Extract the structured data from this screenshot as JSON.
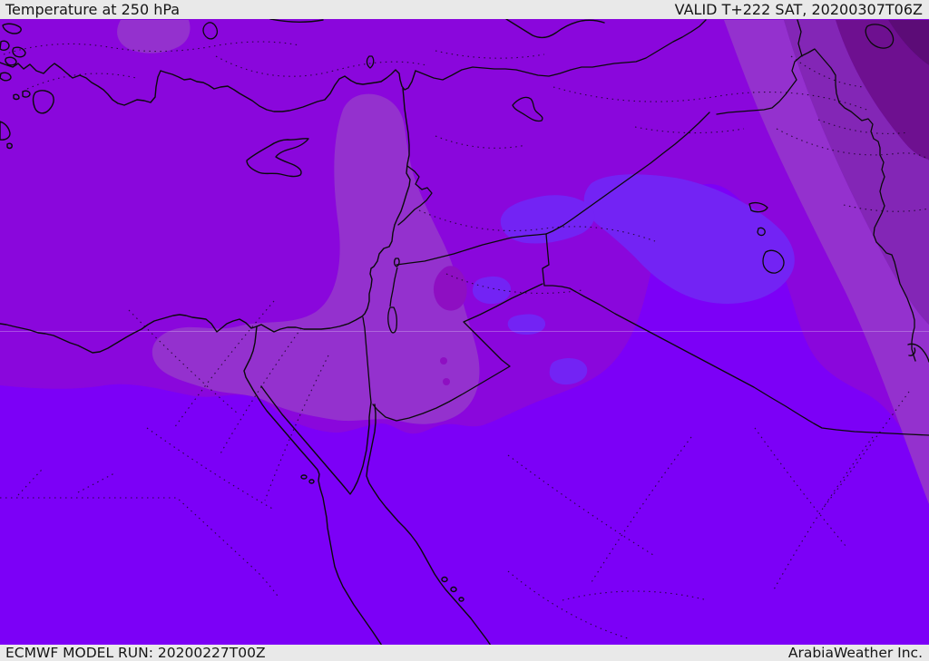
{
  "header": {
    "title": "Temperature at 250 hPa",
    "valid_time": "VALID T+222 SAT, 20200307T06Z"
  },
  "footer": {
    "model_run": "ECMWF MODEL RUN: 20200227T00Z",
    "credit": "ArabiaWeather Inc."
  },
  "map": {
    "region": "Middle East / Eastern Mediterranean",
    "palette": {
      "base_north": "#8A07DC",
      "south_warm": "#7C00F7",
      "cold_patch": "#7323F4",
      "muted_band": "#9431CE",
      "mid_band": "#8326B6",
      "dark_band": "#6E1090",
      "darkest_corner": "#5C0C77",
      "warm_blob": "#8E0FC2",
      "line_color": "#0A0A0A",
      "dotted_contour": "#1A0526",
      "graticule": "#D9BCF2",
      "bar_bg": "#E9E9E9",
      "bar_text": "#161616"
    }
  }
}
